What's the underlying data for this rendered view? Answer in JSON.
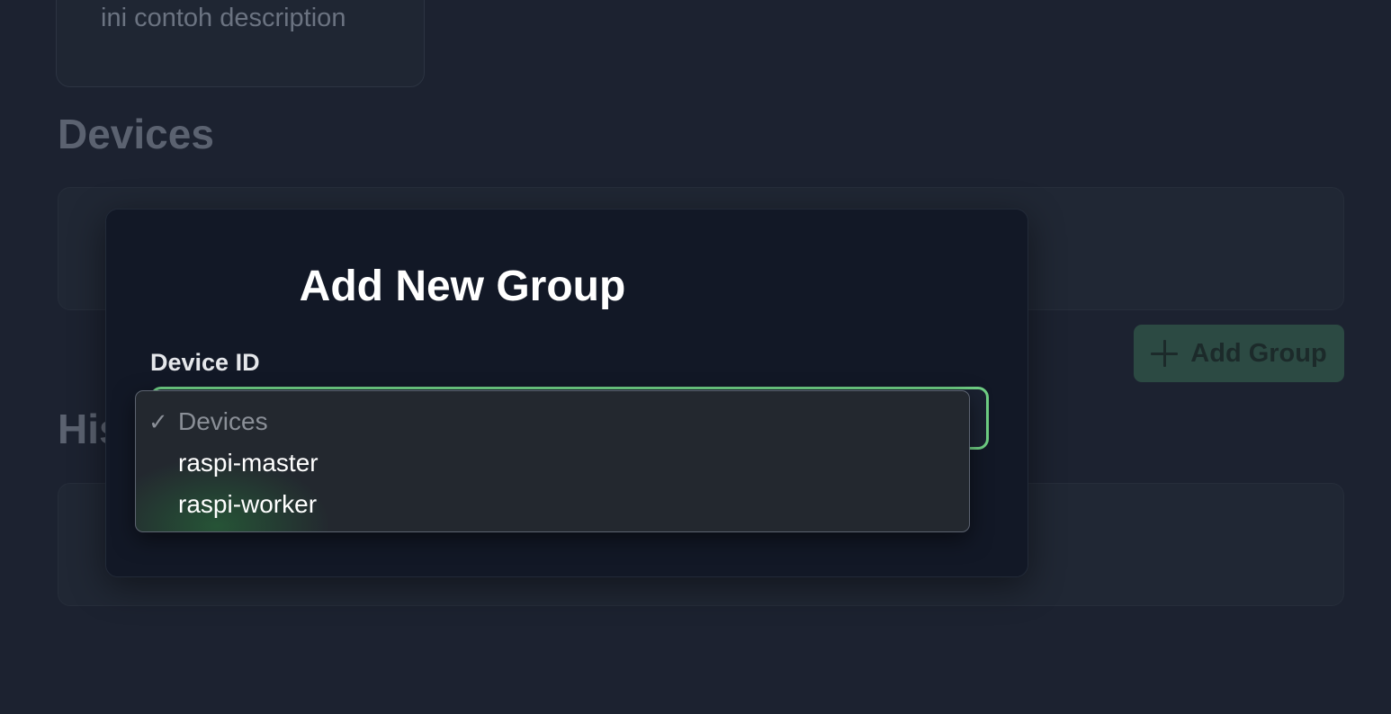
{
  "background": {
    "description_card": {
      "text": "ini contoh description"
    },
    "devices_section": {
      "title": "Devices"
    },
    "history_section": {
      "title": "History"
    },
    "add_group_button": {
      "label": "Add Group",
      "icon": "plus-icon"
    }
  },
  "modal": {
    "title": "Add New Group",
    "device_id_field": {
      "label": "Device ID",
      "selected_value": "Devices",
      "accent_color": "#6fcf84"
    }
  },
  "dropdown": {
    "options": [
      {
        "label": "Devices",
        "selected": true
      },
      {
        "label": "raspi-master",
        "selected": false
      },
      {
        "label": "raspi-worker",
        "selected": false
      }
    ]
  },
  "colors": {
    "page_background": "#1c2230",
    "modal_background": "#121826",
    "button_background": "#2c4a43"
  }
}
